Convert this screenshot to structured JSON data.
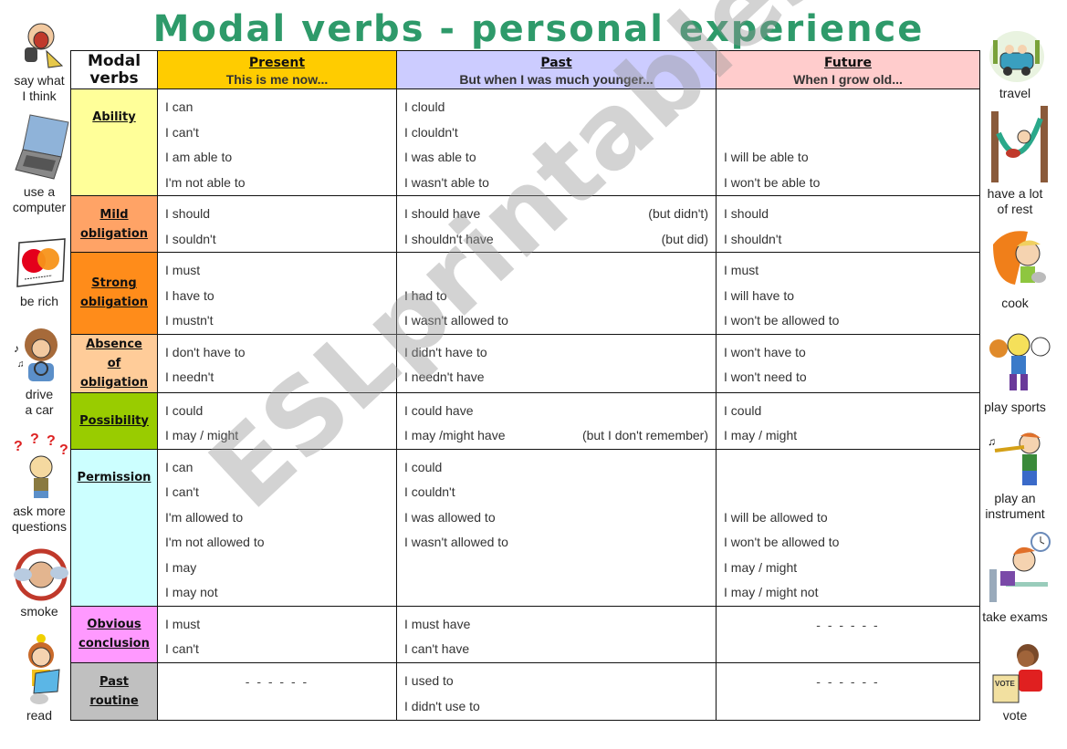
{
  "title": "Modal verbs - personal experience",
  "watermark": "ESLprintables.com",
  "header": {
    "corner_label": "Modal verbs",
    "columns": [
      {
        "title": "Present",
        "subtitle": "This is me now...",
        "color": "#ffcc00"
      },
      {
        "title": "Past",
        "subtitle": "But when I was much younger...",
        "color": "#ccccff"
      },
      {
        "title": "Future",
        "subtitle": "When I grow old...",
        "color": "#ffcccc"
      }
    ]
  },
  "rows": [
    {
      "category": [
        "Ability"
      ],
      "color": "#ffff99",
      "present": [
        [
          "I can",
          ""
        ],
        [
          "I can't",
          ""
        ],
        [
          "I am able to",
          ""
        ],
        [
          "I'm not able to",
          ""
        ]
      ],
      "past": [
        [
          "I clould",
          ""
        ],
        [
          "I clouldn't",
          ""
        ],
        [
          "I was able to",
          ""
        ],
        [
          "I wasn't able to",
          ""
        ]
      ],
      "future": [
        [
          "",
          ""
        ],
        [
          "",
          ""
        ],
        [
          "I will be able to",
          ""
        ],
        [
          "I won't be able to",
          ""
        ]
      ]
    },
    {
      "category": [
        "Mild",
        "obligation"
      ],
      "color": "#ffa366",
      "present": [
        [
          "I should",
          ""
        ],
        [
          "I souldn't",
          ""
        ]
      ],
      "past": [
        [
          "I should have",
          "(but didn't)"
        ],
        [
          "I shouldn't have",
          "(but did)"
        ]
      ],
      "future": [
        [
          "I should",
          ""
        ],
        [
          "I shouldn't",
          ""
        ]
      ]
    },
    {
      "category": [
        "Strong",
        "obligation"
      ],
      "color": "#ff8c1a",
      "present": [
        [
          "I must",
          ""
        ],
        [
          "I have to",
          ""
        ],
        [
          "I mustn't",
          ""
        ]
      ],
      "past": [
        [
          "",
          ""
        ],
        [
          "I had to",
          ""
        ],
        [
          "I wasn't allowed to",
          ""
        ]
      ],
      "future": [
        [
          "I must",
          ""
        ],
        [
          "I will have to",
          ""
        ],
        [
          "I won't be allowed to",
          ""
        ]
      ]
    },
    {
      "category": [
        "Absence",
        "of",
        "obligation"
      ],
      "color": "#ffcc99",
      "present": [
        [
          "I don't have to",
          ""
        ],
        [
          "I needn't",
          ""
        ]
      ],
      "past": [
        [
          "I didn't have to",
          ""
        ],
        [
          "I needn't have",
          ""
        ]
      ],
      "future": [
        [
          "I won't have to",
          ""
        ],
        [
          "I won't need to",
          ""
        ]
      ]
    },
    {
      "category": [
        "Possibility"
      ],
      "color": "#99cc00",
      "present": [
        [
          "I could",
          ""
        ],
        [
          "I may / might",
          ""
        ]
      ],
      "past": [
        [
          "I could have",
          ""
        ],
        [
          "I may /might have",
          "(but I don't remember)"
        ]
      ],
      "future": [
        [
          "I could",
          ""
        ],
        [
          "I may / might",
          ""
        ]
      ]
    },
    {
      "category": [
        "Permission"
      ],
      "color": "#ccffff",
      "present": [
        [
          "I can",
          ""
        ],
        [
          "I can't",
          ""
        ],
        [
          "I'm allowed to",
          ""
        ],
        [
          "I'm not allowed to",
          ""
        ],
        [
          "I may",
          ""
        ],
        [
          "I may not",
          ""
        ]
      ],
      "past": [
        [
          "I could",
          ""
        ],
        [
          "I couldn't",
          ""
        ],
        [
          "I was allowed to",
          ""
        ],
        [
          "I wasn't allowed to",
          ""
        ],
        [
          "",
          ""
        ],
        [
          "",
          ""
        ]
      ],
      "future": [
        [
          "",
          ""
        ],
        [
          "",
          ""
        ],
        [
          "I will be allowed to",
          ""
        ],
        [
          "I won't be allowed to",
          ""
        ],
        [
          "I may / might",
          ""
        ],
        [
          "I may / might not",
          ""
        ]
      ]
    },
    {
      "category": [
        "Obvious",
        "conclusion"
      ],
      "color": "#ff99ff",
      "present": [
        [
          "I must",
          ""
        ],
        [
          "I can't",
          ""
        ]
      ],
      "past": [
        [
          "I must have",
          ""
        ],
        [
          "I can't have",
          ""
        ]
      ],
      "future_dash": "- - - - - -"
    },
    {
      "category": [
        "Past",
        "routine"
      ],
      "color": "#c0c0c0",
      "present_dash": "- - - - - -",
      "past": [
        [
          "I used to",
          ""
        ],
        [
          "I didn't use to",
          ""
        ]
      ],
      "future_dash": "- - - - - -"
    }
  ],
  "left_pictures": [
    {
      "label": "say what\nI think",
      "icon": "shouting-man-icon"
    },
    {
      "label": "use a\ncomputer",
      "icon": "laptop-icon"
    },
    {
      "label": "be rich",
      "icon": "credit-card-icon"
    },
    {
      "label": "drive\na car",
      "icon": "driving-woman-icon"
    },
    {
      "label": "ask more\nquestions",
      "icon": "question-boy-icon"
    },
    {
      "label": "smoke",
      "icon": "smoking-man-icon"
    },
    {
      "label": "read",
      "icon": "reading-girl-icon"
    }
  ],
  "right_pictures": [
    {
      "label": "travel",
      "icon": "car-travel-icon"
    },
    {
      "label": "have a lot\nof rest",
      "icon": "hammock-icon"
    },
    {
      "label": "cook",
      "icon": "cooking-boy-icon"
    },
    {
      "label": "play sports",
      "icon": "sports-kid-icon"
    },
    {
      "label": "play an\ninstrument",
      "icon": "trumpet-boy-icon"
    },
    {
      "label": "take exams",
      "icon": "exam-boy-icon"
    },
    {
      "label": "vote",
      "icon": "voting-boy-icon"
    }
  ]
}
